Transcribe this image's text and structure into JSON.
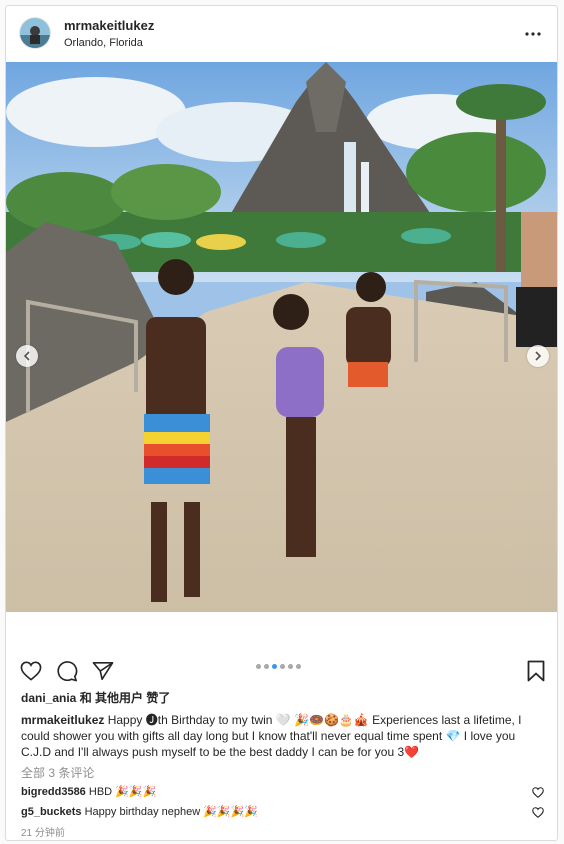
{
  "post": {
    "username": "mrmakeitlukez",
    "location": "Orlando, Florida"
  },
  "carousel": {
    "total_slides": 6,
    "active_index": 2
  },
  "likes_text": "dani_ania 和 其他用户 赞了",
  "caption": {
    "username": "mrmakeitlukez",
    "text": "Happy 🅙th Birthday to my twin 🤍 🎉🍩🍪🎂🎪 Experiences last a lifetime, I could shower you with gifts all day long but I know that'll never equal time spent 💎 I love you C.J.D and I'll always push myself to be the best daddy I can be for you 3❤️"
  },
  "view_all_comments": "全部 3 条评论",
  "comments": [
    {
      "username": "bigredd3586",
      "text": "HBD 🎉🎉🎉"
    },
    {
      "username": "g5_buckets",
      "text": "Happy birthday nephew 🎉🎉🎉🎉"
    }
  ],
  "timestamp": "21 分钟前",
  "icons": {
    "like": "heart-icon",
    "comment": "comment-bubble-icon",
    "share": "paper-plane-icon",
    "save": "bookmark-icon",
    "more": "more-dots-icon"
  }
}
